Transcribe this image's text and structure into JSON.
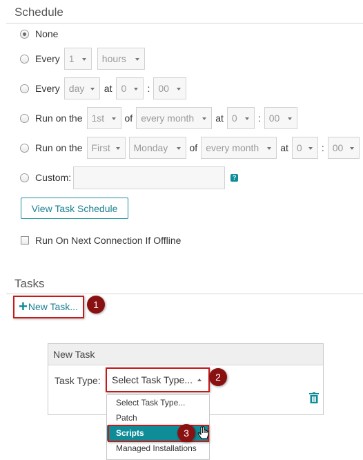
{
  "schedule": {
    "title": "Schedule",
    "none_label": "None",
    "every_hours": {
      "label": "Every",
      "count": "1",
      "unit": "hours"
    },
    "every_day": {
      "label": "Every",
      "unit": "day",
      "at": "at",
      "hour": "0",
      "colon": ":",
      "minute": "00"
    },
    "run_on_day": {
      "label": "Run on the",
      "day": "1st",
      "of": "of",
      "period": "every month",
      "at": "at",
      "hour": "0",
      "colon": ":",
      "minute": "00"
    },
    "run_on_weekday": {
      "label": "Run on the",
      "ordinal": "First",
      "weekday": "Monday",
      "of": "of",
      "period": "every month",
      "at": "at",
      "hour": "0",
      "colon": ":",
      "minute": "00"
    },
    "custom": {
      "label": "Custom:",
      "value": "",
      "help": "?"
    },
    "view_button": "View Task Schedule",
    "offline_label": "Run On Next Connection If Offline"
  },
  "tasks": {
    "title": "Tasks",
    "new_task_icon": "+",
    "new_task_label": "New Task...",
    "panel": {
      "title": "New Task",
      "task_type_label": "Task Type:",
      "task_type_value": "Select Task Type...",
      "options": [
        "Select Task Type...",
        "Patch",
        "Scripts",
        "Managed Installations"
      ],
      "selected_option": "Scripts"
    }
  },
  "callouts": [
    "1",
    "2",
    "3"
  ],
  "colors": {
    "accent": "#0e8c98",
    "callout": "#c41a1a",
    "badge": "#8a1111"
  }
}
